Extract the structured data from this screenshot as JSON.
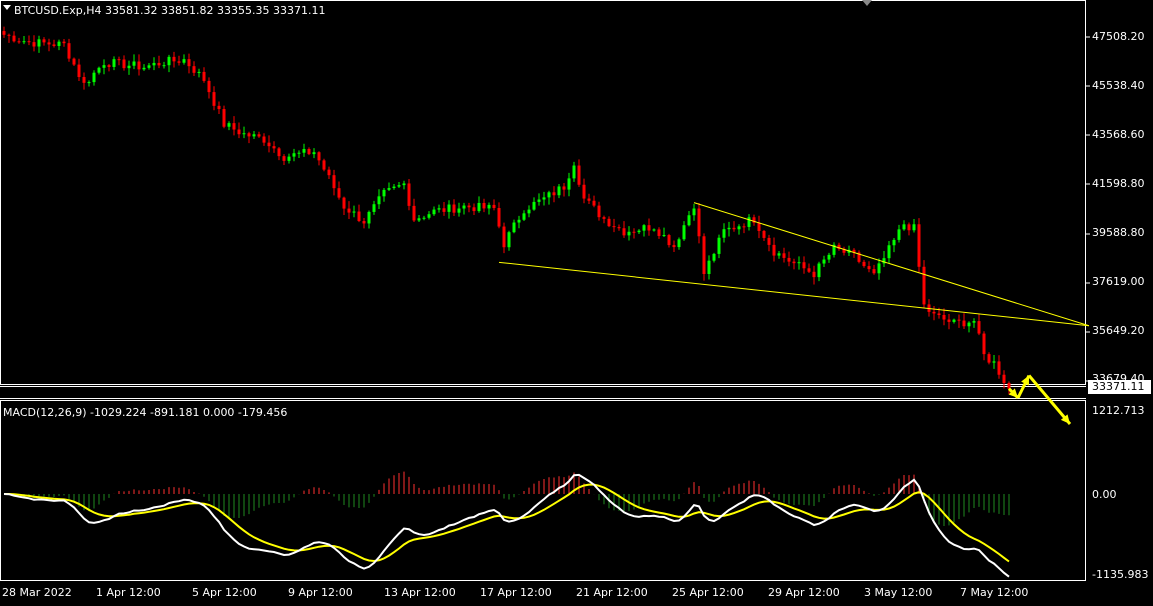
{
  "header": {
    "symbol_info": "BTCUSD.Exp,H4  33581.32 33851.82 33355.35 33371.11",
    "menu_icon": "triangle-down-icon",
    "shift_icon": "chart-shift-icon"
  },
  "price_axis": {
    "labels": [
      "47508.20",
      "45538.40",
      "43568.60",
      "41598.80",
      "39588.80",
      "37619.00",
      "35649.20",
      "33679.40"
    ],
    "current_price": "33371.11"
  },
  "macd": {
    "label": "MACD(12,26,9) -1029.224 -891.181 0.000 -179.456",
    "axis_labels": [
      "1212.713",
      "0.00",
      "-1135.983"
    ]
  },
  "time_axis": {
    "labels": [
      "28 Mar 2022",
      "1 Apr 12:00",
      "5 Apr 12:00",
      "9 Apr 12:00",
      "13 Apr 12:00",
      "17 Apr 12:00",
      "21 Apr 12:00",
      "25 Apr 12:00",
      "29 Apr 12:00",
      "3 May 12:00",
      "7 May 12:00"
    ]
  },
  "colors": {
    "bull": "#00ff00",
    "bear": "#ff0000",
    "trendline": "#ffff00",
    "macd_main": "#ffffff",
    "macd_signal": "#ffff00",
    "hist_pos": "#ff3030",
    "hist_neg": "#1f8a1f",
    "axis": "#ffffff",
    "background": "#000000"
  },
  "chart_data": {
    "type": "candlestick",
    "timeframe": "H4",
    "ylim": [
      33371,
      48200
    ],
    "anchors": [
      {
        "t": 0,
        "p": 47600
      },
      {
        "t": 5,
        "p": 47300
      },
      {
        "t": 12,
        "p": 47200
      },
      {
        "t": 16,
        "p": 45600
      },
      {
        "t": 20,
        "p": 46500
      },
      {
        "t": 28,
        "p": 46300
      },
      {
        "t": 32,
        "p": 46500
      },
      {
        "t": 36,
        "p": 46600
      },
      {
        "t": 40,
        "p": 45800
      },
      {
        "t": 44,
        "p": 44000
      },
      {
        "t": 48,
        "p": 43600
      },
      {
        "t": 52,
        "p": 43400
      },
      {
        "t": 56,
        "p": 42700
      },
      {
        "t": 62,
        "p": 42900
      },
      {
        "t": 64,
        "p": 42200
      },
      {
        "t": 68,
        "p": 40700
      },
      {
        "t": 72,
        "p": 40100
      },
      {
        "t": 76,
        "p": 41200
      },
      {
        "t": 80,
        "p": 41600
      },
      {
        "t": 82,
        "p": 40200
      },
      {
        "t": 86,
        "p": 40500
      },
      {
        "t": 92,
        "p": 40700
      },
      {
        "t": 98,
        "p": 40600
      },
      {
        "t": 100,
        "p": 39200
      },
      {
        "t": 104,
        "p": 40600
      },
      {
        "t": 108,
        "p": 41000
      },
      {
        "t": 112,
        "p": 41500
      },
      {
        "t": 114,
        "p": 42500
      },
      {
        "t": 116,
        "p": 41000
      },
      {
        "t": 120,
        "p": 40200
      },
      {
        "t": 124,
        "p": 39700
      },
      {
        "t": 130,
        "p": 39900
      },
      {
        "t": 134,
        "p": 39100
      },
      {
        "t": 138,
        "p": 40800
      },
      {
        "t": 140,
        "p": 38000
      },
      {
        "t": 144,
        "p": 39700
      },
      {
        "t": 150,
        "p": 40200
      },
      {
        "t": 154,
        "p": 38900
      },
      {
        "t": 158,
        "p": 38400
      },
      {
        "t": 162,
        "p": 38000
      },
      {
        "t": 166,
        "p": 39000
      },
      {
        "t": 170,
        "p": 38700
      },
      {
        "t": 174,
        "p": 37900
      },
      {
        "t": 178,
        "p": 39300
      },
      {
        "t": 180,
        "p": 40000
      },
      {
        "t": 182,
        "p": 39800
      },
      {
        "t": 184,
        "p": 36700
      },
      {
        "t": 186,
        "p": 36300
      },
      {
        "t": 190,
        "p": 36000
      },
      {
        "t": 194,
        "p": 36100
      },
      {
        "t": 196,
        "p": 34700
      },
      {
        "t": 198,
        "p": 34400
      },
      {
        "t": 201,
        "p": 33371
      }
    ],
    "trendlines": [
      {
        "t1": 99,
        "p1": 38450,
        "t2": 217,
        "p2": 35900
      },
      {
        "t1": 138,
        "p1": 40850,
        "t2": 217,
        "p2": 35900
      }
    ],
    "projection_path_prices": [
      33371,
      33000,
      33900,
      32400
    ]
  }
}
